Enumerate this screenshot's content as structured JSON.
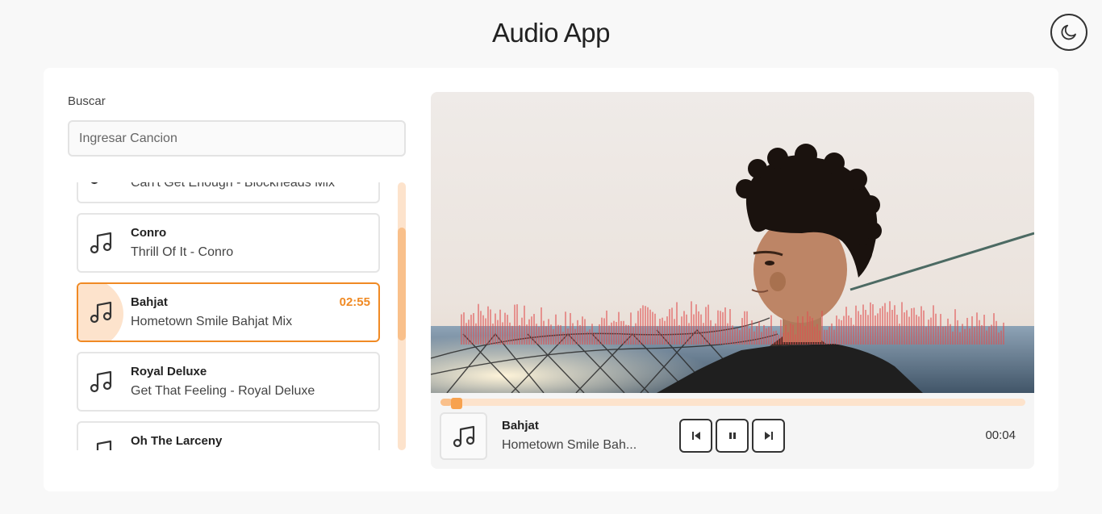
{
  "app": {
    "title": "Audio App"
  },
  "header": {
    "theme_toggle_icon": "moon-icon"
  },
  "search": {
    "label": "Buscar",
    "placeholder": "Ingresar Cancion",
    "value": ""
  },
  "songs": [
    {
      "artist": "",
      "title": "Can't Get Enough - Blockheads Mix",
      "duration": "",
      "icon": "music-note-icon",
      "active": false
    },
    {
      "artist": "Conro",
      "title": "Thrill Of It - Conro",
      "duration": "",
      "icon": "music-note-icon",
      "active": false
    },
    {
      "artist": "Bahjat",
      "title": "Hometown Smile Bahjat Mix",
      "duration": "02:55",
      "icon": "music-note-icon",
      "active": true
    },
    {
      "artist": "Royal Deluxe",
      "title": "Get That Feeling - Royal Deluxe",
      "duration": "",
      "icon": "music-note-icon",
      "active": false
    },
    {
      "artist": "Oh The Larceny",
      "title": "",
      "duration": "",
      "icon": "music-note-icon",
      "active": false
    }
  ],
  "player": {
    "progress_fraction": 0.02,
    "now_playing": {
      "artist": "Bahjat",
      "title": "Hometown Smile Bah...",
      "elapsed": "00:04"
    },
    "controls": {
      "prev_icon": "skip-back-icon",
      "pause_icon": "pause-icon",
      "next_icon": "skip-forward-icon"
    }
  },
  "colors": {
    "accent": "#f08a24",
    "accent_light": "#fde3cc",
    "accent_mid": "#f9c08b",
    "waveform": "#e05050"
  }
}
